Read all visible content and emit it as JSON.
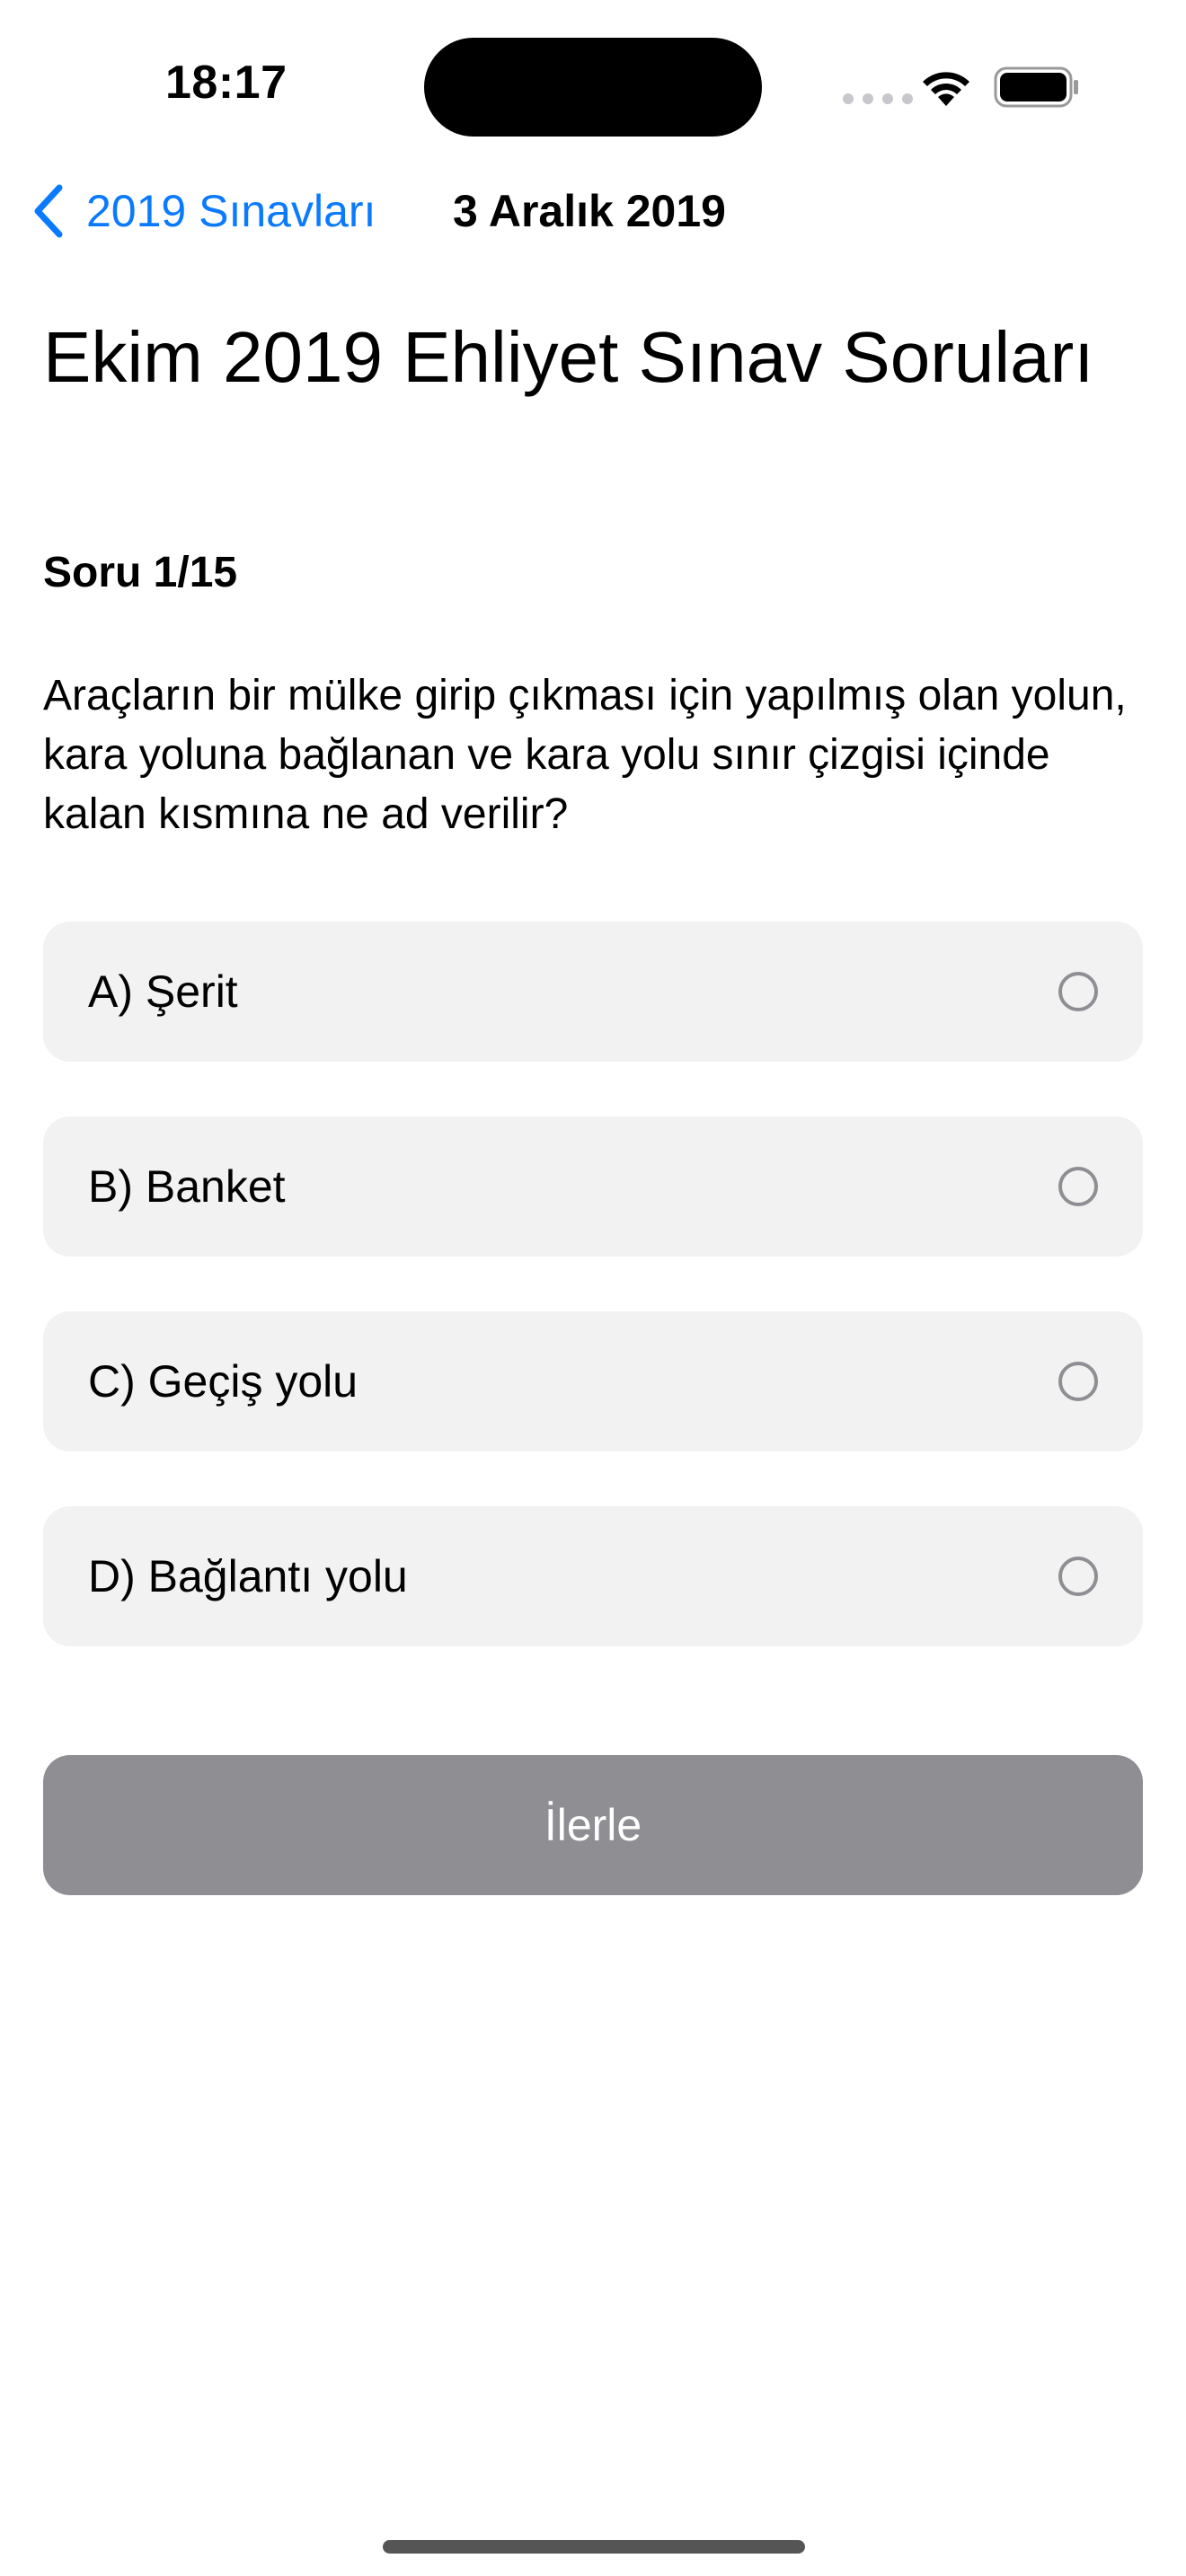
{
  "status_bar": {
    "time": "18:17"
  },
  "nav": {
    "back_label": "2019 Sınavları",
    "title": "3 Aralık 2019"
  },
  "page": {
    "title": "Ekim 2019 Ehliyet Sınav Soruları",
    "question_counter": "Soru 1/15",
    "question_text": "Araçların bir mülke girip çıkması için yapılmış olan yolun, kara yoluna bağlanan ve kara yolu sınır çizgisi içinde kalan kısmına ne ad verilir?"
  },
  "options": [
    {
      "label": "A) Şerit"
    },
    {
      "label": "B) Banket"
    },
    {
      "label": "C) Geçiş yolu"
    },
    {
      "label": "D) Bağlantı yolu"
    }
  ],
  "next_button": {
    "label": "İlerle"
  },
  "colors": {
    "accent": "#0a7aff",
    "option_background": "#f2f2f2",
    "button_disabled": "#8e8e93"
  },
  "icons": {
    "back": "chevron-left-icon",
    "wifi": "wifi-icon",
    "battery": "battery-icon",
    "signal": "cellular-signal-icon",
    "radio": "radio-unselected-icon"
  }
}
